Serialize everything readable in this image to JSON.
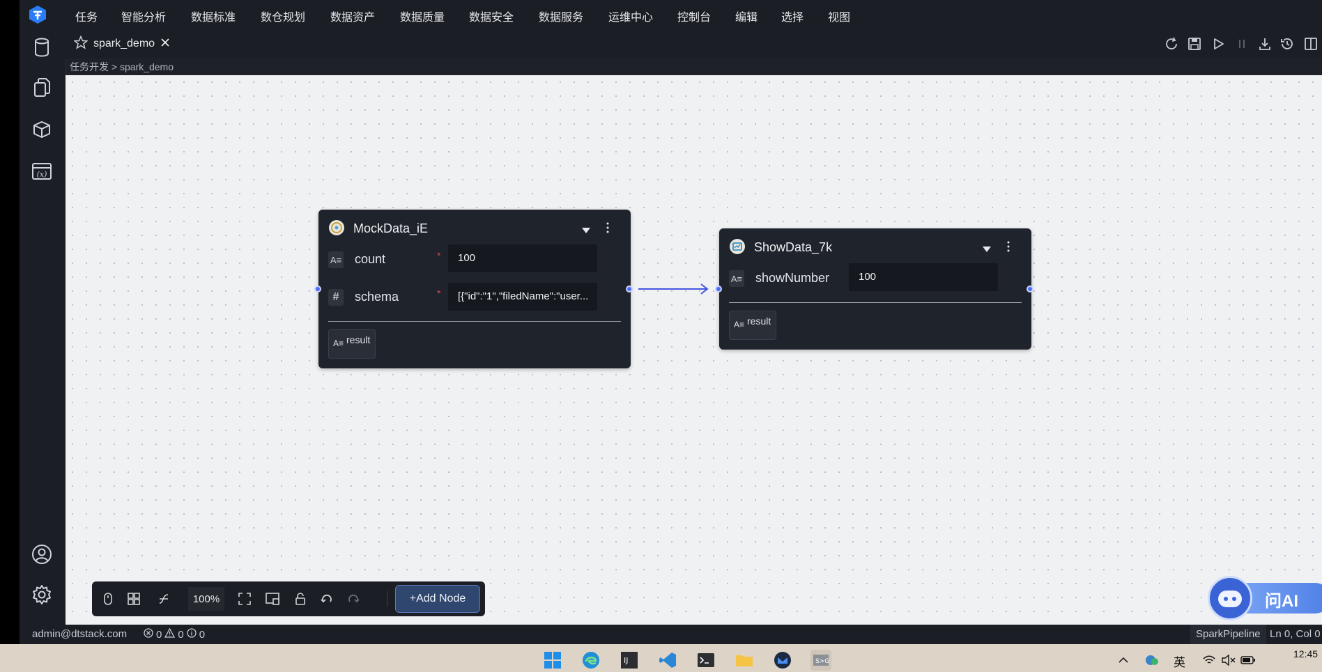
{
  "menu": [
    "任务",
    "智能分析",
    "数据标准",
    "数仓规划",
    "数据资产",
    "数据质量",
    "数据安全",
    "数据服务",
    "运维中心",
    "控制台",
    "编辑",
    "选择",
    "视图"
  ],
  "tab": {
    "name": "spark_demo"
  },
  "breadcrumb": {
    "parent": "任务开发",
    "separator": ">",
    "current": "spark_demo"
  },
  "nodes": {
    "mock": {
      "title": "MockData_iE",
      "fields": [
        {
          "icon": "A≡",
          "label": "count",
          "required": "*",
          "value": "100"
        },
        {
          "icon": "#",
          "label": "schema",
          "required": "*",
          "value": "[{\"id\":\"1\",\"filedName\":\"user..."
        }
      ],
      "output": "result"
    },
    "show": {
      "title": "ShowData_7k",
      "fields": [
        {
          "icon": "A≡",
          "label": "showNumber",
          "value": "100"
        }
      ],
      "output": "result"
    }
  },
  "toolbar": {
    "zoom": "100%",
    "add_node": "+Add Node"
  },
  "status": {
    "user": "admin@dtstack.com",
    "errors": "0",
    "warnings": "0",
    "infos": "0",
    "language": "SparkPipeline",
    "cursor": "Ln 0, Col 0"
  },
  "ai": {
    "label": "问AI"
  },
  "tray": {
    "ime": "英",
    "time": "12:45"
  },
  "colors": {
    "accent": "#4e6ef2",
    "node_bg": "#1f232b",
    "canvas": "#f0f1f3"
  }
}
